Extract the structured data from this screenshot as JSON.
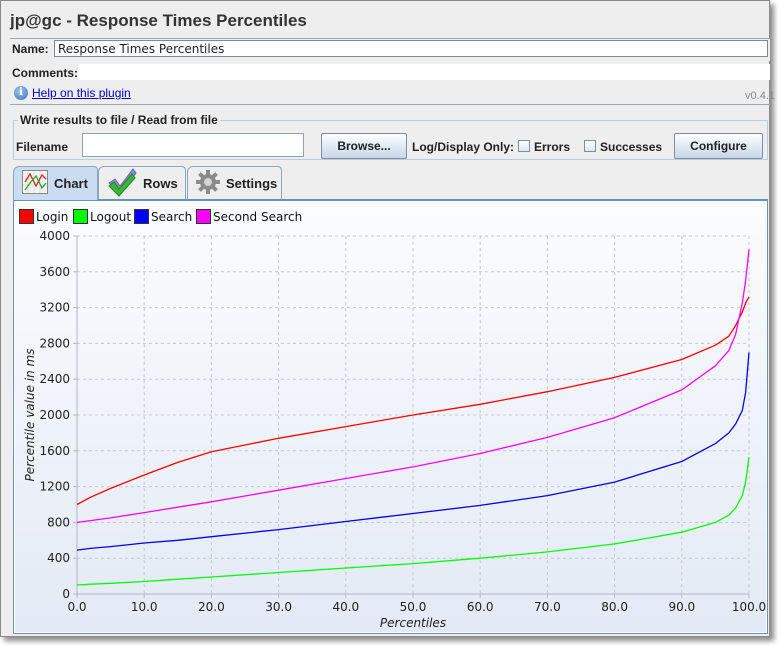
{
  "window": {
    "title": "jp@gc - Response Times Percentiles",
    "name_label": "Name:",
    "name_value": "Response Times Percentiles",
    "comments_label": "Comments:",
    "comments_value": "",
    "help_link": "Help on this plugin",
    "version": "v0.4.1"
  },
  "file_panel": {
    "legend": "Write results to file / Read from file",
    "filename_label": "Filename",
    "filename_value": "",
    "browse_label": "Browse...",
    "log_display_label": "Log/Display Only:",
    "errors_label": "Errors",
    "errors_checked": false,
    "successes_label": "Successes",
    "successes_checked": false,
    "configure_label": "Configure"
  },
  "tabs": [
    {
      "label": "Chart",
      "icon": "chart-icon",
      "active": true
    },
    {
      "label": "Rows",
      "icon": "checkmark-icon",
      "active": false
    },
    {
      "label": "Settings",
      "icon": "gear-icon",
      "active": false
    }
  ],
  "chart_data": {
    "type": "line",
    "title": "",
    "xlabel": "Percentiles",
    "ylabel": "Percentile value in ms",
    "xlim": [
      0,
      100
    ],
    "ylim": [
      0,
      4000
    ],
    "xticks": [
      "0.0",
      "10.0",
      "20.0",
      "30.0",
      "40.0",
      "50.0",
      "60.0",
      "70.0",
      "80.0",
      "90.0",
      "100.0"
    ],
    "yticks": [
      "0",
      "400",
      "800",
      "1200",
      "1600",
      "2000",
      "2400",
      "2800",
      "3200",
      "3600",
      "4000"
    ],
    "grid": true,
    "legend_position": "top-left",
    "x": [
      0,
      2,
      5,
      10,
      15,
      20,
      30,
      40,
      50,
      60,
      70,
      80,
      90,
      95,
      97,
      98,
      99,
      99.5,
      100
    ],
    "series": [
      {
        "name": "Login",
        "color": "#ff0000",
        "values": [
          1000,
          1080,
          1180,
          1330,
          1470,
          1590,
          1740,
          1870,
          2000,
          2120,
          2260,
          2420,
          2620,
          2780,
          2880,
          3000,
          3150,
          3250,
          3320
        ]
      },
      {
        "name": "Logout",
        "color": "#00ff00",
        "values": [
          100,
          110,
          120,
          140,
          165,
          190,
          240,
          290,
          340,
          400,
          470,
          560,
          690,
          800,
          880,
          960,
          1100,
          1250,
          1530
        ]
      },
      {
        "name": "Search",
        "color": "#0000ff",
        "values": [
          490,
          510,
          530,
          570,
          600,
          640,
          720,
          810,
          900,
          990,
          1100,
          1250,
          1480,
          1680,
          1800,
          1900,
          2050,
          2250,
          2700
        ]
      },
      {
        "name": "Second Search",
        "color": "#ff00ff",
        "values": [
          800,
          820,
          850,
          910,
          970,
          1030,
          1160,
          1290,
          1420,
          1570,
          1750,
          1970,
          2280,
          2550,
          2720,
          2900,
          3250,
          3500,
          3850
        ]
      }
    ]
  }
}
